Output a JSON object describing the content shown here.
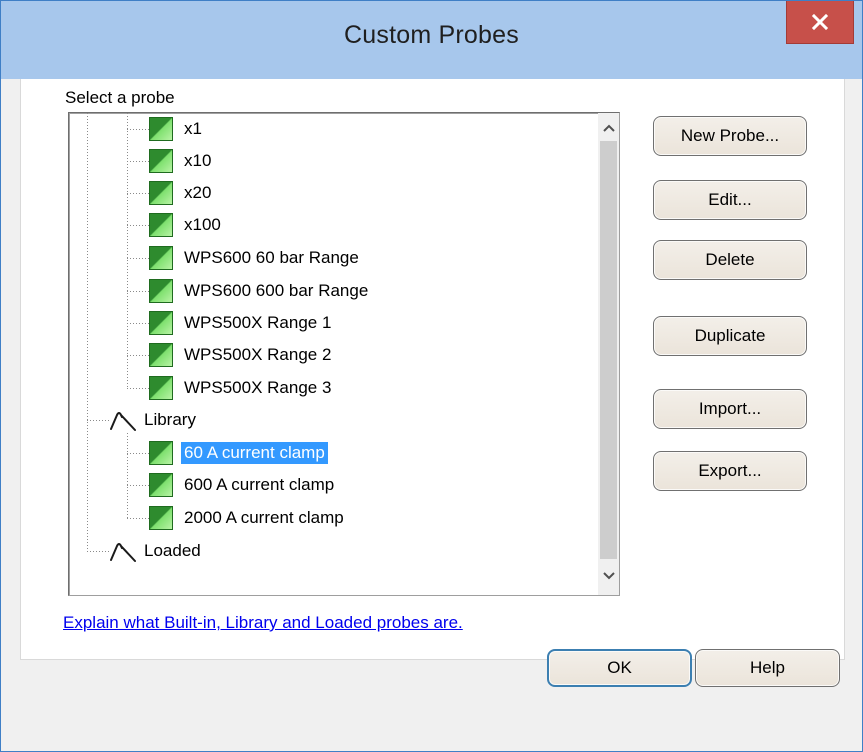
{
  "window": {
    "title": "Custom Probes",
    "close_icon": "close-icon"
  },
  "probe_section": {
    "label": "Select a probe"
  },
  "tree": {
    "items": [
      {
        "label": "x1",
        "type": "probe",
        "level": 2
      },
      {
        "label": "x10",
        "type": "probe",
        "level": 2
      },
      {
        "label": "x20",
        "type": "probe",
        "level": 2
      },
      {
        "label": "x100",
        "type": "probe",
        "level": 2
      },
      {
        "label": "WPS600 60 bar Range",
        "type": "probe",
        "level": 2
      },
      {
        "label": "WPS600 600 bar Range",
        "type": "probe",
        "level": 2
      },
      {
        "label": "WPS500X Range 1",
        "type": "probe",
        "level": 2
      },
      {
        "label": "WPS500X Range 2",
        "type": "probe",
        "level": 2
      },
      {
        "label": "WPS500X Range 3",
        "type": "probe",
        "level": 2
      },
      {
        "label": "Library",
        "type": "group",
        "level": 1
      },
      {
        "label": "60 A current clamp",
        "type": "probe",
        "level": 2,
        "selected": true
      },
      {
        "label": "600 A current clamp",
        "type": "probe",
        "level": 2
      },
      {
        "label": "2000 A current clamp",
        "type": "probe",
        "level": 2
      },
      {
        "label": "Loaded",
        "type": "group",
        "level": 1
      }
    ]
  },
  "buttons": {
    "new_probe": "New Probe...",
    "edit": "Edit...",
    "delete": "Delete",
    "duplicate": "Duplicate",
    "import": "Import...",
    "export": "Export..."
  },
  "help_link": "Explain what Built-in, Library and Loaded probes are.",
  "footer": {
    "ok": "OK",
    "help": "Help"
  },
  "colors": {
    "titlebar": "#a7c7ec",
    "close_button": "#c7504a",
    "selection": "#3399ff",
    "probe_icon": "#2e8b2e",
    "link": "#0000ee"
  }
}
